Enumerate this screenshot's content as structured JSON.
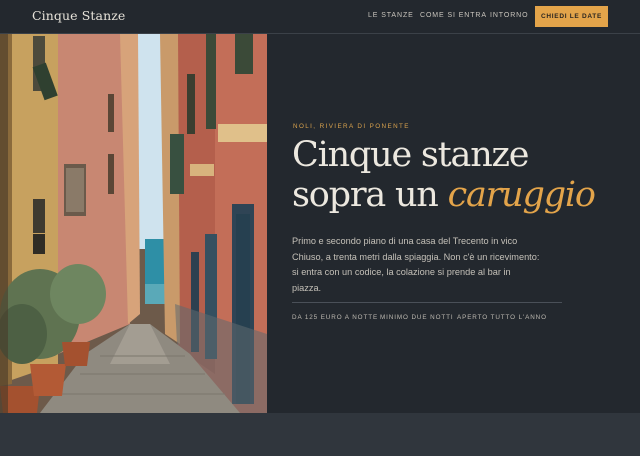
{
  "header": {
    "brand": "Cinque Stanze",
    "nav": [
      "LE STANZE",
      "COME SI ENTRA",
      "INTORNO"
    ],
    "cta_label": "CHIEDI LE DATE"
  },
  "hero": {
    "eyebrow": "NOLI, RIVIERA DI PONENTE",
    "title_line1": "Cinque stanze",
    "title_line2_prefix": "sopra un ",
    "title_accent": "caruggio",
    "lead": "Primo e secondo piano di una casa del Trecento in vico Chiuso, a trenta metri dalla spiaggia. Non c'è un ricevimento: si entra con un codice, la colazione si prende al bar in piazza.",
    "facts": [
      "DA 125 EURO A NOTTE",
      "MINIMO DUE NOTTI",
      "APERTO TUTTO L'ANNO"
    ]
  },
  "colors": {
    "accent": "#e3a44a",
    "background": "#23282e",
    "header_bg": "#23282e"
  }
}
